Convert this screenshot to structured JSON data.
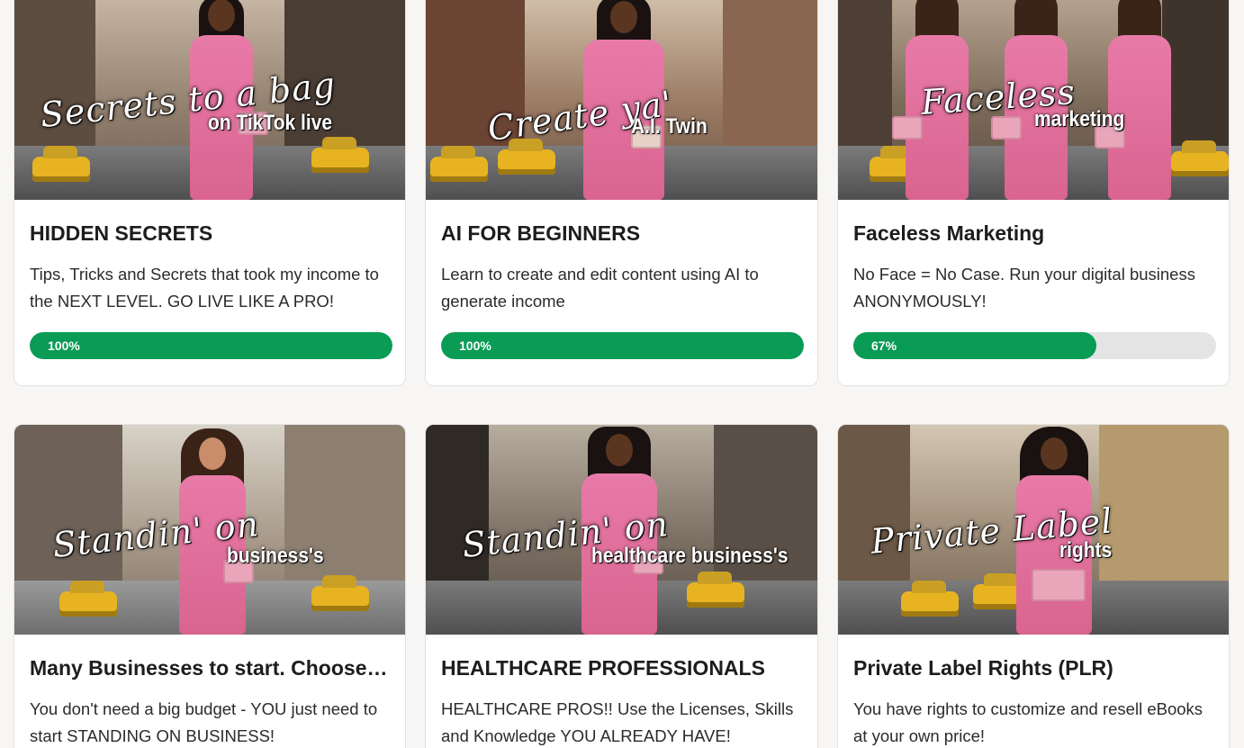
{
  "courses": [
    {
      "overlay_script": "Secrets to a bag",
      "overlay_sub": "on TikTok live",
      "title": "HIDDEN SECRETS",
      "description": "Tips, Tricks and Secrets that took my income to the NEXT LEVEL. GO LIVE LIKE A PRO!",
      "progress_label": "100%",
      "progress": 1.0
    },
    {
      "overlay_script": "Create ya'",
      "overlay_sub": "A.I. Twin",
      "title": "AI FOR BEGINNERS",
      "description": "Learn to create and edit content using AI to generate income",
      "progress_label": "100%",
      "progress": 1.0
    },
    {
      "overlay_script": "Faceless",
      "overlay_sub": "marketing",
      "title": "Faceless Marketing",
      "description": "No Face = No Case. Run your digital business ANONYMOUSLY!",
      "progress_label": "67%",
      "progress": 0.67
    },
    {
      "overlay_script": "Standin' on",
      "overlay_sub": "business's",
      "title": "Many Businesses to start. Choose…",
      "description": "You don't need a big budget - YOU just need to start STANDING ON BUSINESS!"
    },
    {
      "overlay_script": "Standin' on",
      "overlay_sub": "healthcare business's",
      "title": "HEALTHCARE PROFESSIONALS",
      "description": "HEALTHCARE PROS!! Use the Licenses, Skills and Knowledge YOU ALREADY HAVE!"
    },
    {
      "overlay_script": "Private Label",
      "overlay_sub": "rights",
      "title": "Private Label Rights (PLR)",
      "description": "You have rights to customize and resell eBooks at your own price!"
    }
  ],
  "colors": {
    "progress_fill": "#0a9b55",
    "progress_track": "#e4e4e4",
    "outfit_pink": "#e87aa8",
    "taxi_yellow": "#e7b321"
  }
}
